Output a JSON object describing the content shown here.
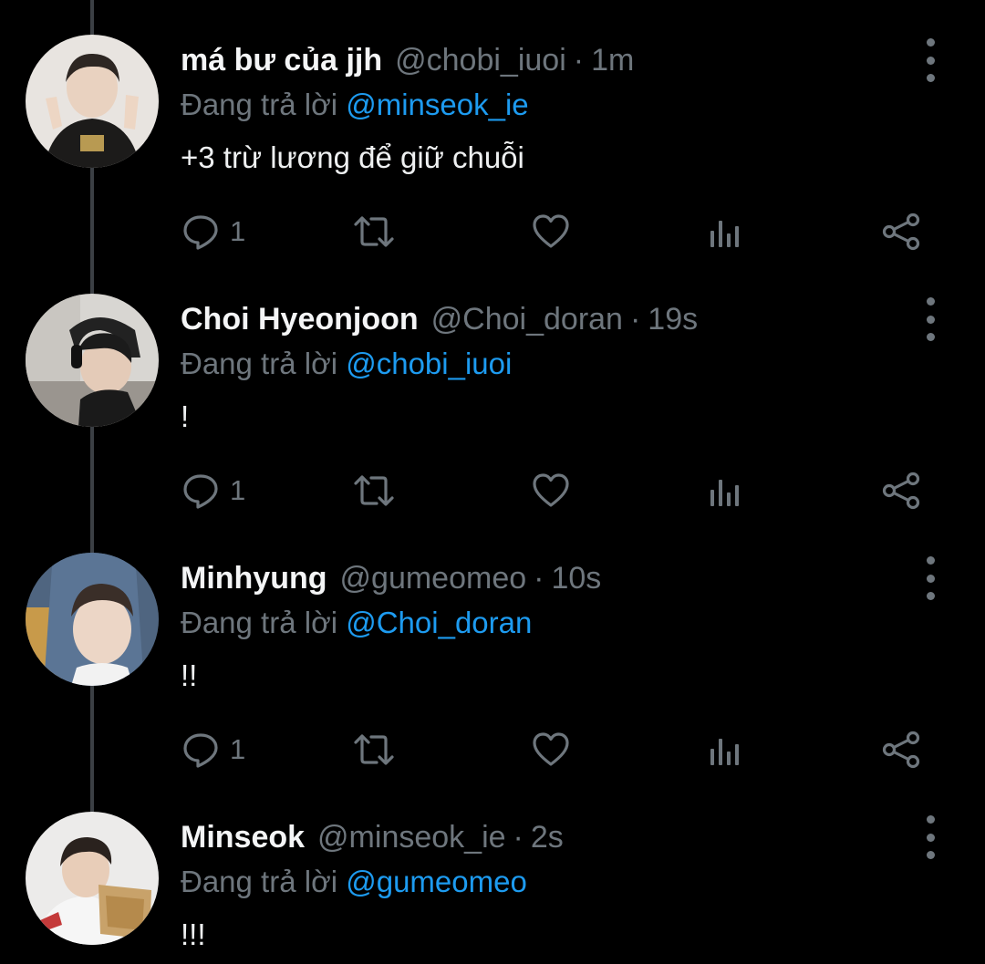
{
  "colors": {
    "background": "#000000",
    "name": "#f4f5f6",
    "secondary": "#6e767d",
    "mention": "#1d9bf0",
    "thread_line": "#3b3f44"
  },
  "reply_prefix": "Đang trả lời",
  "icons": {
    "more": "more-vertical-icon",
    "reply": "reply-icon",
    "retweet": "retweet-icon",
    "like": "heart-icon",
    "views": "bar-chart-icon",
    "share": "share-icon"
  },
  "tweets": [
    {
      "name": "má bư của jjh",
      "handle": "@chobi_iuoi",
      "separator": "·",
      "time": "1m",
      "reply_to": "@minseok_ie",
      "text": "+3 trừ lương để giữ chuỗi",
      "reply_count": "1"
    },
    {
      "name": "Choi Hyeonjoon",
      "handle": "@Choi_doran",
      "separator": "·",
      "time": "19s",
      "reply_to": "@chobi_iuoi",
      "text": "!",
      "reply_count": "1"
    },
    {
      "name": "Minhyung",
      "handle": "@gumeomeo",
      "separator": "·",
      "time": "10s",
      "reply_to": "@Choi_doran",
      "text": "!!",
      "reply_count": "1"
    },
    {
      "name": "Minseok",
      "handle": "@minseok_ie",
      "separator": "·",
      "time": "2s",
      "reply_to": "@gumeomeo",
      "text": "!!!"
    }
  ]
}
